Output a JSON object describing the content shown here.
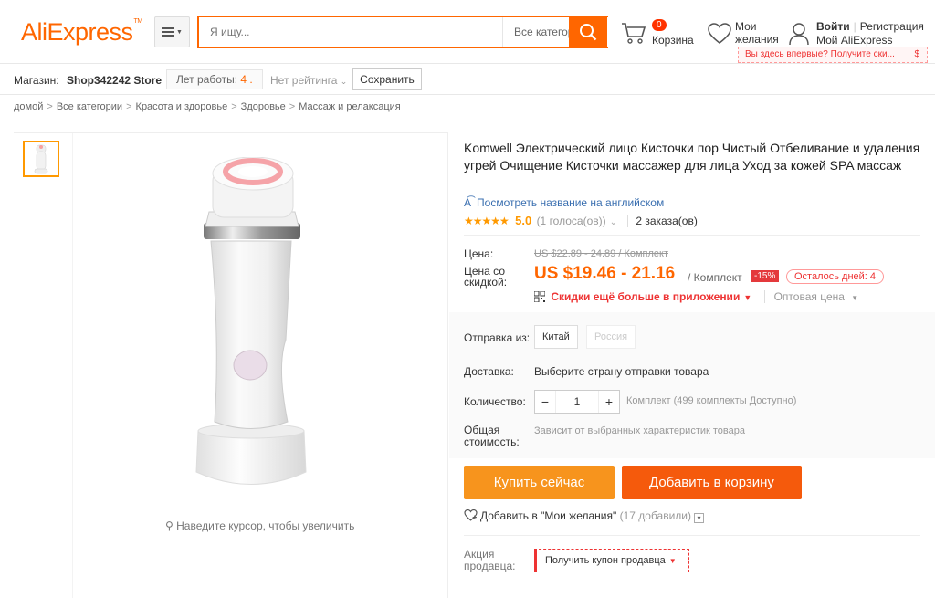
{
  "header": {
    "logo": "AliExpress",
    "logo_tm": "TM",
    "search_placeholder": "Я ищу...",
    "search_category": "Все категории",
    "cart_count": "0",
    "cart_label": "Корзина",
    "wishlist_label_1": "Мои",
    "wishlist_label_2": "желания",
    "signin": "Войти",
    "register": "Регистрация",
    "my_account": "Мой AliExpress",
    "promo_tip": "Вы здесь впервые? Получите ски...",
    "promo_dollar": "$"
  },
  "store": {
    "label": "Магазин:",
    "name": "Shop342242 Store",
    "years_label": "Лет работы:",
    "years_value": "4 .",
    "rating": "Нет рейтинга",
    "save": "Сохранить"
  },
  "breadcrumb": [
    "домой",
    "Все категории",
    "Красота и здоровье",
    "Здоровье",
    "Массаж и релаксация"
  ],
  "gallery": {
    "zoom_hint": "Наведите курсор, чтобы увеличить"
  },
  "product": {
    "title": "Komwell Электрический лицо Кисточки пор Чистый Отбеливание и удаления угрей Очищение Кисточки массажер для лица Уход за кожей SPA массаж",
    "translate_link": "Посмотреть название на английском",
    "stars": "★★★★★",
    "rating_score": "5.0",
    "rating_votes": "(1 голоса(ов))",
    "orders": "2 заказа(ов)",
    "price_label": "Цена:",
    "old_price": "US $22.89 - 24.89 / Комплект",
    "discount_price_label": "Цена со скидкой:",
    "new_price": "US $19.46 - 21.16",
    "unit": "/ Комплект",
    "discount_badge": "-15%",
    "days_left": "Осталось дней: 4",
    "app_deal": "Скидки ещё больше в приложении",
    "wholesale": "Оптовая цена",
    "ship_from_label": "Отправка из:",
    "ship_options": [
      "Китай",
      "Россия"
    ],
    "delivery_label": "Доставка:",
    "delivery_value": "Выберите страну отправки товара",
    "qty_label": "Количество:",
    "qty_value": "1",
    "qty_minus": "−",
    "qty_plus": "+",
    "stock": "Комплект (499 комплекты Доступно)",
    "total_label": "Общая стоимость:",
    "total_value": "Зависит от выбранных характеристик товара",
    "buy_now": "Купить сейчас",
    "add_to_cart": "Добавить в корзину",
    "wishlist_add": "Добавить в \"Мои желания\"",
    "wishlist_count": "(17 добавили)",
    "promo_label": "Акция продавца:",
    "coupon": "Получить купон продавца"
  },
  "colors": {
    "accent": "#ff6600",
    "buy": "#f7941d",
    "cart": "#f55a0c",
    "sale": "#e4393c"
  }
}
